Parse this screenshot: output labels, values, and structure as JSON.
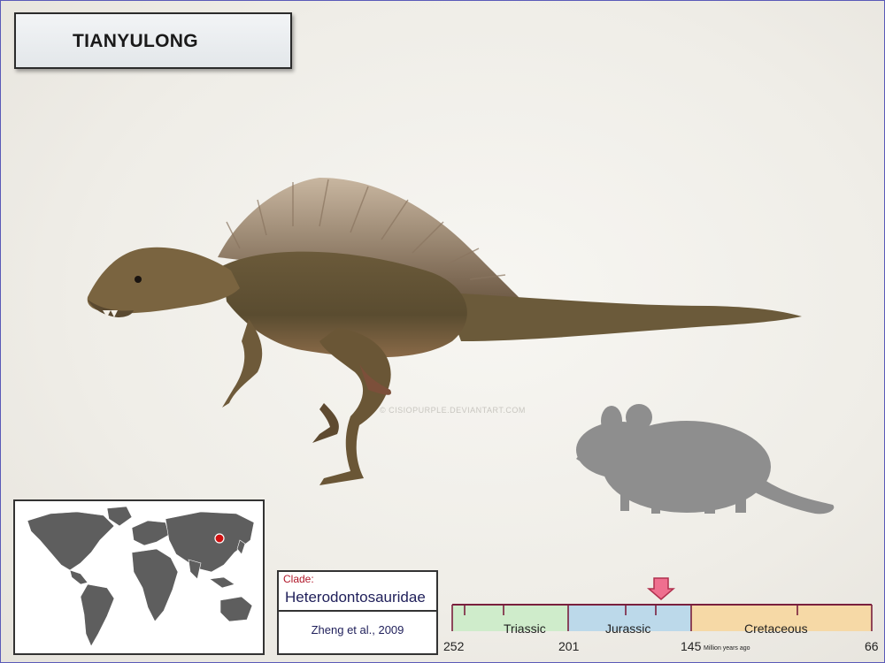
{
  "title": "TIANYULONG",
  "watermark": "© CISIOPURPLE.DEVIANTART.COM",
  "clade": {
    "label": "Clade:",
    "name": "Heterodontosauridae",
    "reference": "Zheng et al., 2009"
  },
  "timeline": {
    "periods": [
      {
        "name": "Triassic",
        "color": "#cfeccb"
      },
      {
        "name": "Jurassic",
        "color": "#bcd9ea"
      },
      {
        "name": "Cretaceous",
        "color": "#f6d9a6"
      }
    ],
    "boundaries": [
      "252",
      "201",
      "145",
      "66"
    ],
    "unit": "Million years ago",
    "marker_color": "#ef6f8f",
    "line_color": "#7a1f3d"
  },
  "icons": {
    "animal": "tianyulong-illustration",
    "scale": "mouse-silhouette",
    "map": "world-map",
    "location": "red-dot"
  },
  "colors": {
    "location": "#d01010",
    "silhouette": "#8e8e8e",
    "map_land": "#5e5e5e"
  }
}
